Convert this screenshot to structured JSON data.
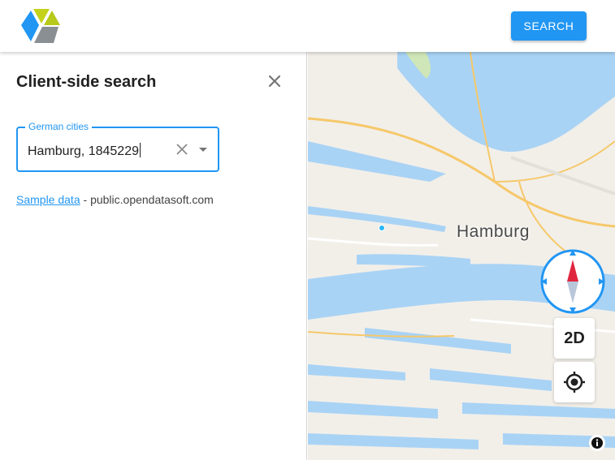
{
  "header": {
    "logo_icon": "cube-logo-icon",
    "search_label": "SEARCH"
  },
  "panel": {
    "title": "Client-side search",
    "close_icon": "close-icon",
    "field": {
      "label": "German cities",
      "value": "Hamburg, 1845229",
      "clear_icon": "clear-icon",
      "dropdown_icon": "dropdown-arrow-icon"
    },
    "source": {
      "link_text": "Sample data",
      "separator": " - ",
      "provider": "public.opendatasoft.com"
    }
  },
  "map": {
    "city_label": "Hamburg",
    "compass_icon": "compass-icon",
    "view_mode_label": "2D",
    "locate_icon": "my-location-icon",
    "attribution_icon": "info-icon"
  },
  "colors": {
    "accent": "#2196f3",
    "water": "#a9d3f5",
    "land": "#f2efe9",
    "road": "#f6c86a",
    "park": "#cfe6b8",
    "compass_red": "#e0263f"
  }
}
